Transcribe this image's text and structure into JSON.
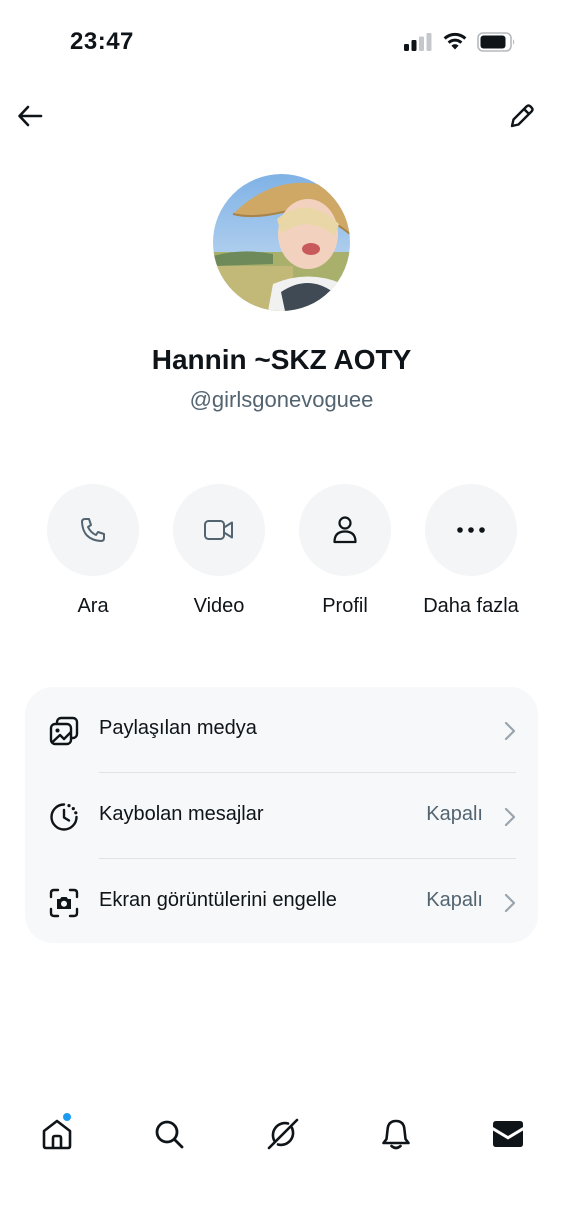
{
  "status_bar": {
    "time": "23:47"
  },
  "profile": {
    "display_name": "Hannin ~SKZ AOTY",
    "username": "@girlsgonevoguee"
  },
  "actions": [
    {
      "label": "Ara",
      "icon": "phone-icon"
    },
    {
      "label": "Video",
      "icon": "video-icon"
    },
    {
      "label": "Profil",
      "icon": "person-icon"
    },
    {
      "label": "Daha fazla",
      "icon": "more-icon"
    }
  ],
  "settings": [
    {
      "label": "Paylaşılan medya",
      "value": "",
      "icon": "shared-media-icon"
    },
    {
      "label": "Kaybolan mesajlar",
      "value": "Kapalı",
      "icon": "disappearing-timer-icon"
    },
    {
      "label": "Ekran görüntülerini engelle",
      "value": "Kapalı",
      "icon": "screenshot-block-icon"
    }
  ],
  "tabbar": {
    "items": [
      "home-icon",
      "search-icon",
      "grok-icon",
      "notifications-icon",
      "messages-icon"
    ]
  },
  "colors": {
    "text": "#0f1419",
    "secondary_text": "#536471",
    "card_background": "#f6f8f9",
    "action_background": "#f3f5f6",
    "badge_blue": "#1d9bf0"
  }
}
